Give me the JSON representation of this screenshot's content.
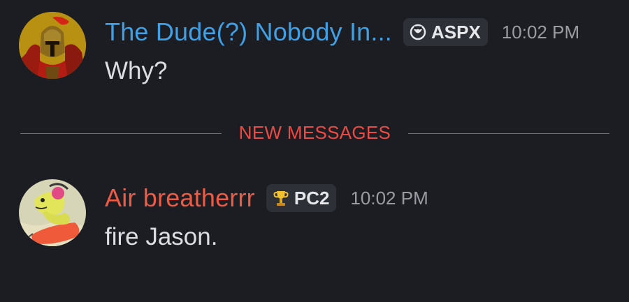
{
  "messages": [
    {
      "username": "The Dude(?) Nobody In...",
      "username_color": "#3fa0e6",
      "tag": {
        "icon": "server-tag-icon",
        "label": "ASPX"
      },
      "timestamp": "10:02 PM",
      "content": "Why?",
      "avatar": "spartan-helmet-avatar"
    },
    {
      "username": "Air breatherrr",
      "username_color": "#ed5b45",
      "tag": {
        "icon": "trophy-icon",
        "label": "PC2"
      },
      "timestamp": "10:02 PM",
      "content": "fire Jason.",
      "avatar": "cartoon-character-avatar"
    }
  ],
  "divider": {
    "label": "NEW MESSAGES",
    "color": "#ee4a44"
  },
  "colors": {
    "background": "#1c1d22",
    "tag_background": "#2e3038",
    "timestamp": "#9b9ca3",
    "message_text": "#dcdde1"
  }
}
